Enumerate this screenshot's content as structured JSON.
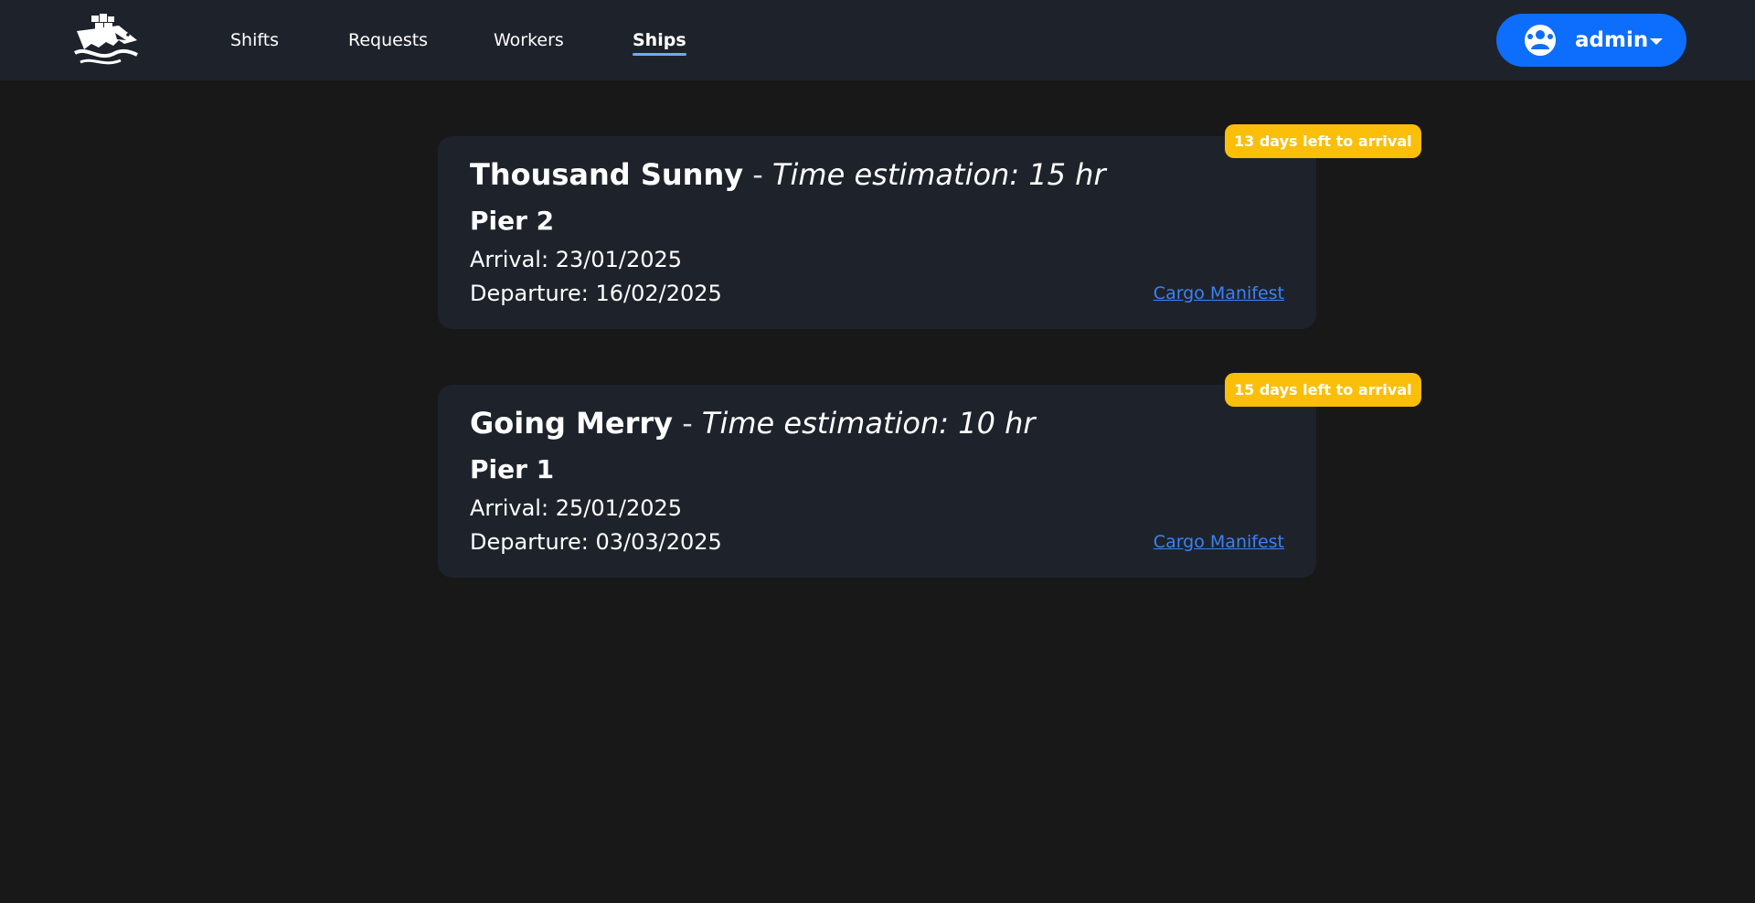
{
  "nav": {
    "logo_icon": "ship-shark-logo-icon",
    "links": [
      {
        "label": "Shifts",
        "active": false
      },
      {
        "label": "Requests",
        "active": false
      },
      {
        "label": "Workers",
        "active": false
      },
      {
        "label": "Ships",
        "active": true
      }
    ],
    "user": {
      "name": "admin",
      "avatar_icon": "avatar-icon",
      "caret_icon": "caret-down-icon"
    }
  },
  "ships": [
    {
      "name": "Thousand Sunny",
      "separator": " - ",
      "estimate": "Time estimation: 15 hr",
      "pier": "Pier 2",
      "arrival": "Arrival: 23/01/2025",
      "departure": "Departure: 16/02/2025",
      "manifest_label": "Cargo Manifest",
      "badge": "13 days left to arrival"
    },
    {
      "name": "Going Merry",
      "separator": " - ",
      "estimate": "Time estimation: 10 hr",
      "pier": "Pier 1",
      "arrival": "Arrival: 25/01/2025",
      "departure": "Departure: 03/03/2025",
      "manifest_label": "Cargo Manifest",
      "badge": "15 days left to arrival"
    }
  ],
  "colors": {
    "background": "#181818",
    "surface": "#1e232b",
    "accent": "#0d6efd",
    "badge": "#fbbf0a",
    "link": "#3b82f6"
  }
}
